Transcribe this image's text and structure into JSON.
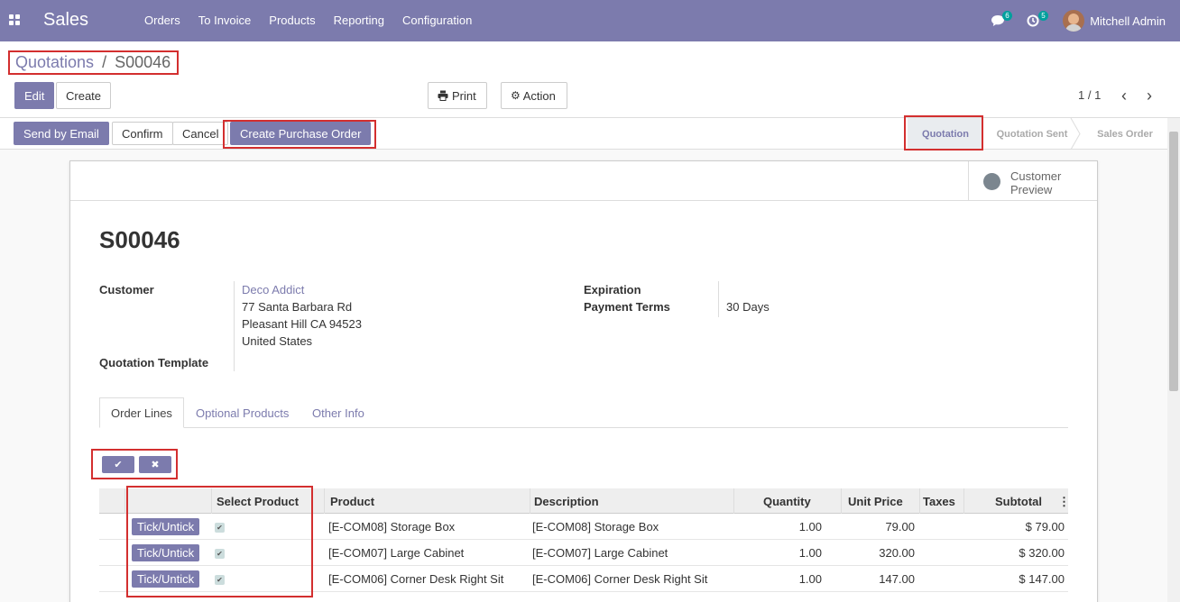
{
  "navbar": {
    "brand": "Sales",
    "menu": [
      "Orders",
      "To Invoice",
      "Products",
      "Reporting",
      "Configuration"
    ],
    "messages_count": "6",
    "activities_count": "5",
    "user_name": "Mitchell Admin"
  },
  "breadcrumb": {
    "parent": "Quotations",
    "separator": "/",
    "current": "S00046"
  },
  "toolbar": {
    "edit": "Edit",
    "create": "Create",
    "print": "Print",
    "action": "Action",
    "pager": "1 / 1"
  },
  "statusbar": {
    "send_email": "Send by Email",
    "confirm": "Confirm",
    "cancel": "Cancel",
    "create_po": "Create Purchase Order",
    "stages": [
      "Quotation",
      "Quotation Sent",
      "Sales Order"
    ],
    "active_stage": "Quotation"
  },
  "sheet": {
    "customer_preview": "Customer Preview",
    "title": "S00046",
    "customer_label": "Customer",
    "customer_name": "Deco Addict",
    "address": [
      "77 Santa Barbara Rd",
      "Pleasant Hill CA 94523",
      "United States"
    ],
    "quotation_template_label": "Quotation Template",
    "expiration_label": "Expiration",
    "payment_terms_label": "Payment Terms",
    "payment_terms": "30 Days",
    "tabs": [
      "Order Lines",
      "Optional Products",
      "Other Info"
    ]
  },
  "table": {
    "headers": [
      "Select Product",
      "Product",
      "Description",
      "Quantity",
      "Unit Price",
      "Taxes",
      "Subtotal"
    ],
    "tick_label": "Tick/Untick",
    "rows": [
      {
        "product": "[E-COM08] Storage Box",
        "description": "[E-COM08] Storage Box",
        "quantity": "1.00",
        "unit_price": "79.00",
        "taxes": "",
        "subtotal": "$ 79.00"
      },
      {
        "product": "[E-COM07] Large Cabinet",
        "description": "[E-COM07] Large Cabinet",
        "quantity": "1.00",
        "unit_price": "320.00",
        "taxes": "",
        "subtotal": "$ 320.00"
      },
      {
        "product": "[E-COM06] Corner Desk Right Sit",
        "description": "[E-COM06] Corner Desk Right Sit",
        "quantity": "1.00",
        "unit_price": "147.00",
        "taxes": "",
        "subtotal": "$ 147.00"
      }
    ]
  },
  "colors": {
    "brand": "#7c7bad",
    "highlight": "#d32f2f",
    "badge": "#00a09d"
  }
}
